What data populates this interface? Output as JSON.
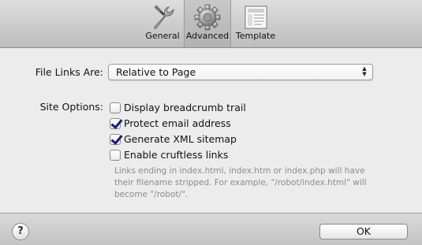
{
  "toolbar": {
    "tabs": [
      {
        "label": "General",
        "icon": "wrench-icon",
        "selected": false
      },
      {
        "label": "Advanced",
        "icon": "gear-icon",
        "selected": true
      },
      {
        "label": "Template",
        "icon": "template-icon",
        "selected": false
      }
    ]
  },
  "file_links": {
    "label": "File Links Are:",
    "selected_value": "Relative to Page"
  },
  "site_options": {
    "label": "Site Options:",
    "options": [
      {
        "label": "Display breadcrumb trail",
        "checked": false
      },
      {
        "label": "Protect email address",
        "checked": true
      },
      {
        "label": "Generate XML sitemap",
        "checked": true
      },
      {
        "label": "Enable cruftless links",
        "checked": false
      }
    ],
    "help_text": "Links ending in index.html, index.htm or index.php will have their filename stripped. For example, \"/robot/index.html\" will become \"/robot/\"."
  },
  "footer": {
    "help_button": "?",
    "ok_button": "OK"
  }
}
